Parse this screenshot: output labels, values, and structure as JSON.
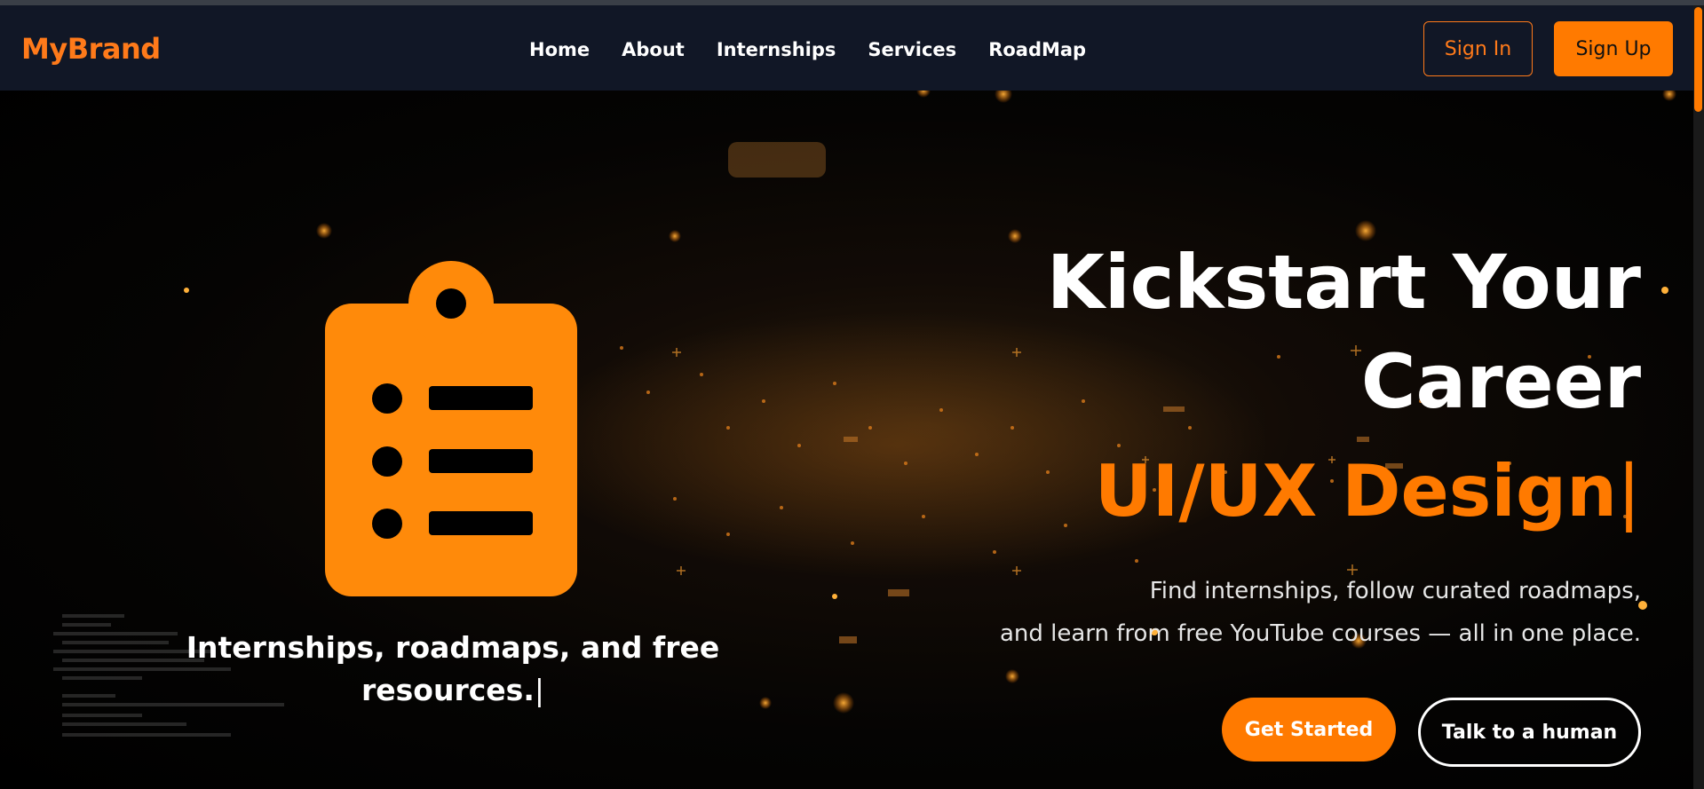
{
  "brand": {
    "name": "MyBrand"
  },
  "nav": {
    "items": [
      {
        "label": "Home"
      },
      {
        "label": "About"
      },
      {
        "label": "Internships"
      },
      {
        "label": "Services"
      },
      {
        "label": "RoadMap"
      }
    ],
    "sign_in": "Sign In",
    "sign_up": "Sign Up"
  },
  "hero": {
    "icon": "clipboard-list-icon",
    "caption_text": "Internships, roadmaps, and free resources.",
    "caption_cursor": "|",
    "headline_line1": "Kickstart Your",
    "headline_line2": "Career",
    "rotating_text": "UI/UX Design",
    "rotating_cursor": "|",
    "description_line1": "Find internships, follow curated roadmaps,",
    "description_line2": "and learn from free YouTube courses — all in one place.",
    "cta_primary": "Get Started",
    "cta_secondary": "Talk to a human"
  },
  "colors": {
    "accent": "#ff7a00",
    "navbar_bg": "#111726",
    "text": "#ffffff"
  }
}
